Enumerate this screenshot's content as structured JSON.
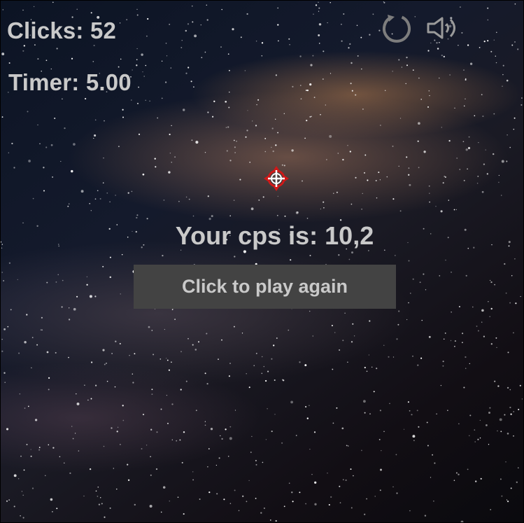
{
  "hud": {
    "clicks_text": "Clicks: 52",
    "timer_text": "Timer: 5.00"
  },
  "controls": {
    "restart_icon": "restart-icon",
    "sound_icon": "speaker-icon"
  },
  "result": {
    "cps_text": "Your cps is: 10,2",
    "play_again_label": "Click to play again"
  },
  "colors": {
    "text": "#c9c9c9",
    "button_bg": "#434343",
    "target_red": "#d01818"
  }
}
